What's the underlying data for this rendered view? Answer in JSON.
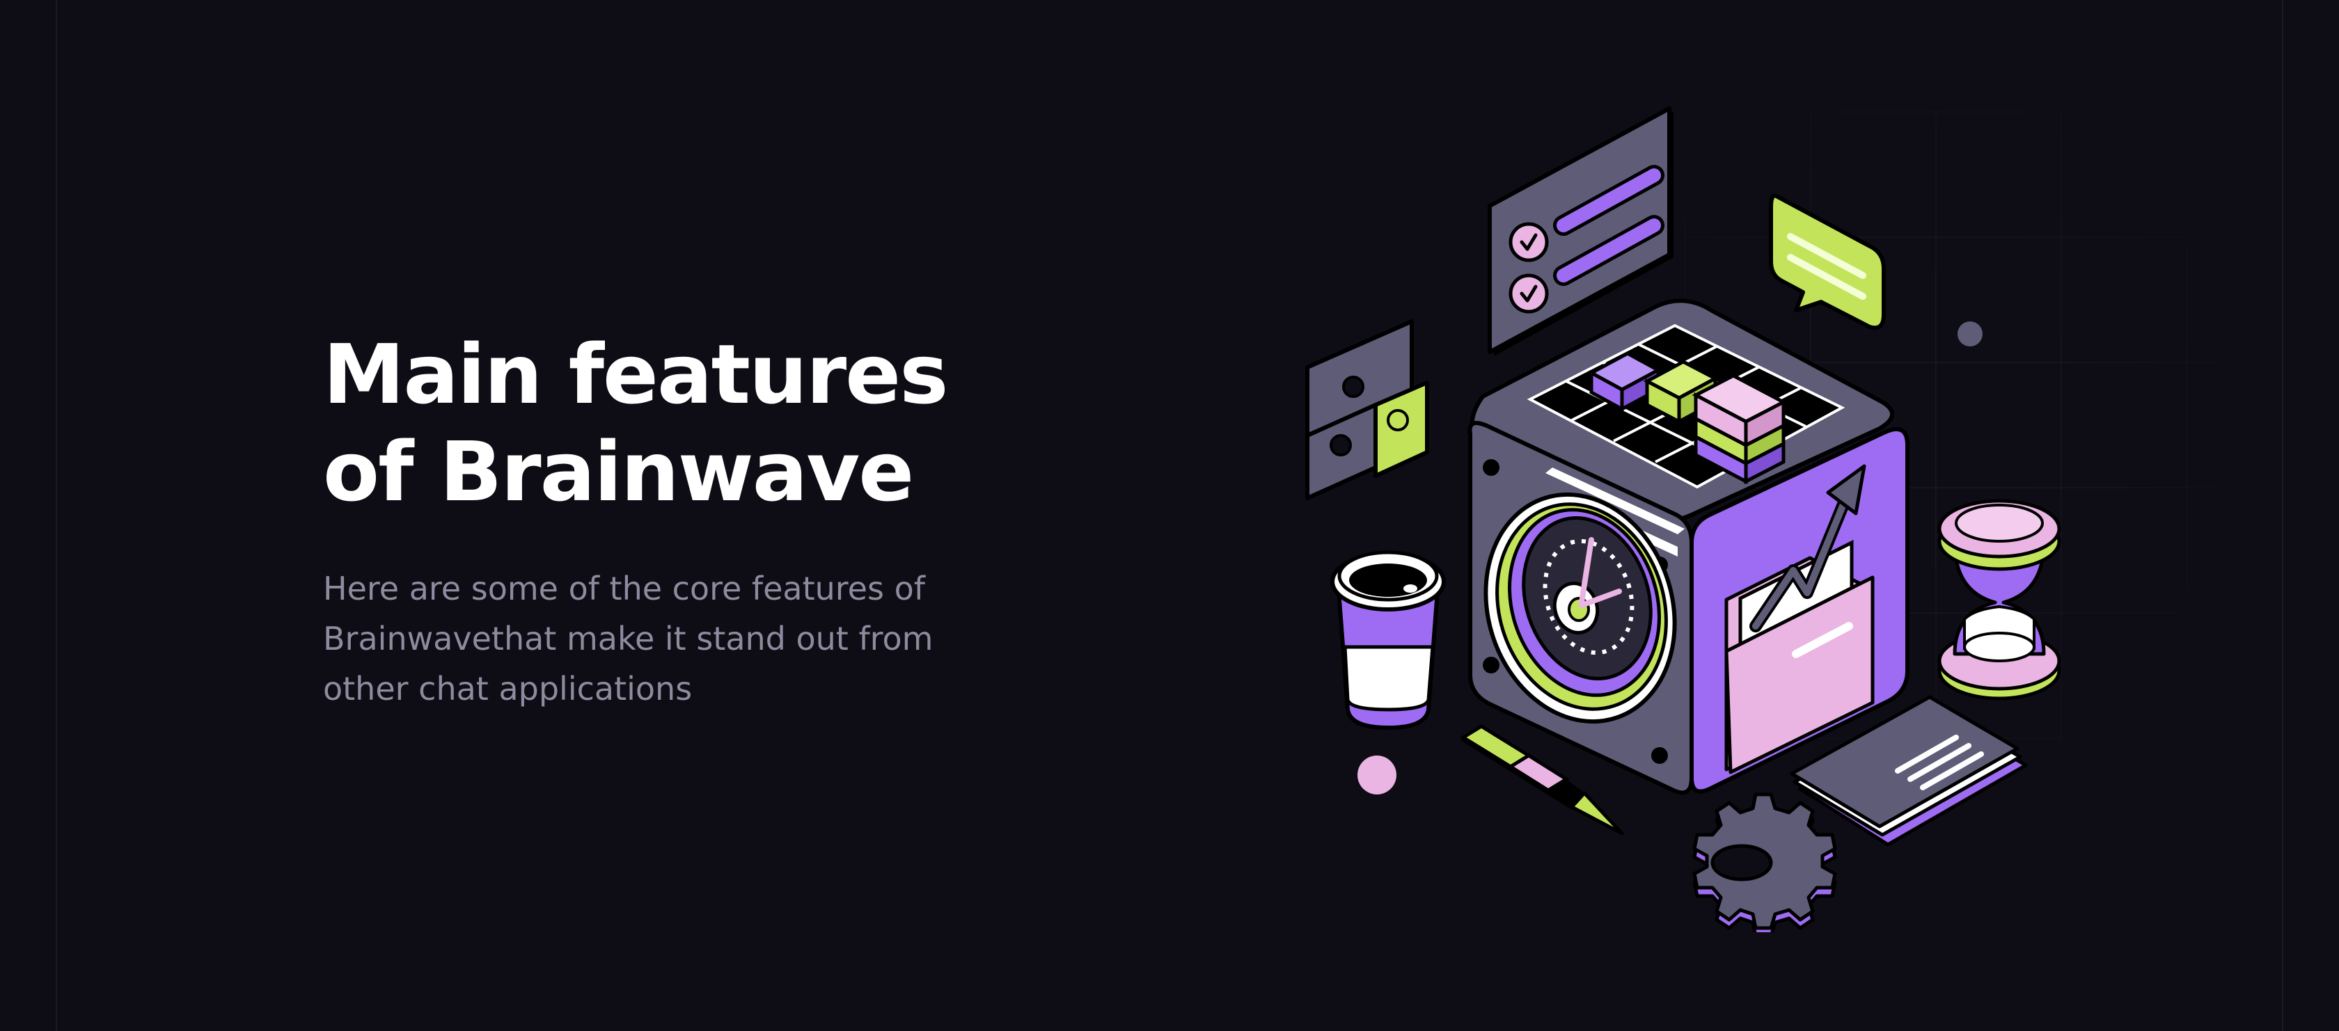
{
  "hero": {
    "title_line1": "Main features",
    "title_line2": "of Brainwave",
    "description_line1": "Here are some of the core features of",
    "description_line2": "Brainwavethat make it stand out from",
    "description_line3": "other chat applications"
  },
  "colors": {
    "background": "#0e0c15",
    "heading": "#ffffff",
    "body_text": "#8e8b9f",
    "purple": "#9e6cf2",
    "lime": "#c3e45a",
    "pink": "#eab4e3",
    "slate": "#5d5a75"
  },
  "illustration": {
    "icons": [
      "checklist-card-icon",
      "chat-bubble-icon",
      "puzzle-icon",
      "coffee-cup-icon",
      "feature-cube-icon",
      "hourglass-icon",
      "notebook-icon",
      "pen-icon",
      "gear-icon"
    ]
  }
}
